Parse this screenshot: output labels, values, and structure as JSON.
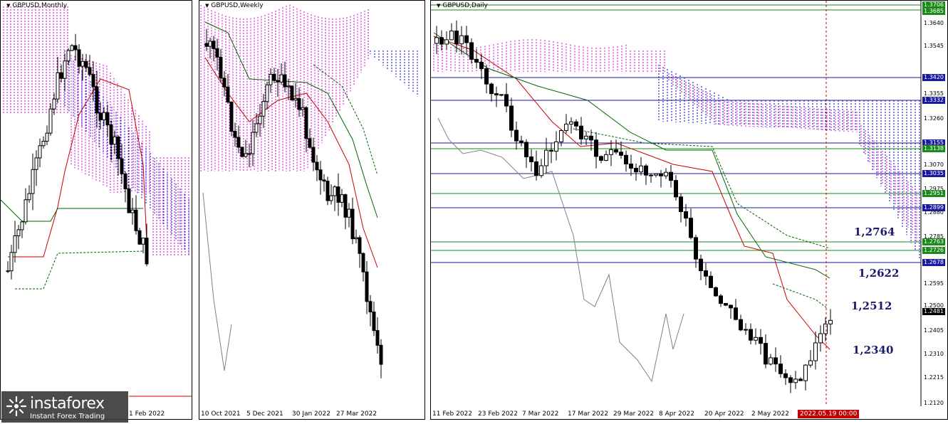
{
  "panels": {
    "monthly": {
      "title": "GBPUSD,Monthly",
      "xlabels": [
        "1 Feb 2022"
      ]
    },
    "weekly": {
      "title": "GBPUSD,Weekly",
      "xlabels": [
        "10 Oct 2021",
        "5 Dec 2021",
        "30 Jan 2022",
        "27 Mar 2022"
      ]
    },
    "daily": {
      "title": "GBPUSD,Daily",
      "xlabels": [
        "11 Feb 2022",
        "23 Feb 2022",
        "7 Mar 2022",
        "17 Mar 2022",
        "29 Mar 2022",
        "8 Apr 2022",
        "20 Apr 2022",
        "2 May 2022"
      ],
      "current_date": "2022.05.19 00:00",
      "price_scale": [
        "1.3640",
        "1.3545",
        "1.3450",
        "1.3355",
        "1.3260",
        "1.3070",
        "1.2975",
        "1.2880",
        "1.2785",
        "1.2595",
        "1.2500",
        "1.2405",
        "1.2310",
        "1.2215",
        "1.2120"
      ],
      "tags": [
        {
          "label": "1.3706",
          "color": "#1a8a1a"
        },
        {
          "label": "1.3685",
          "color": "#1a8a1a"
        },
        {
          "label": "1.3420",
          "color": "#1a1aa0"
        },
        {
          "label": "1.3332",
          "color": "#1a1aa0"
        },
        {
          "label": "1.3155",
          "color": "#1a1aa0"
        },
        {
          "label": "1.3138",
          "color": "#1a8a1a"
        },
        {
          "label": "1.3035",
          "color": "#1a1aa0"
        },
        {
          "label": "1.2951",
          "color": "#1a8a1a"
        },
        {
          "label": "1.2899",
          "color": "#1a1aa0"
        },
        {
          "label": "1.2763",
          "color": "#1a8a1a"
        },
        {
          "label": "1.2726",
          "color": "#1a8a1a"
        },
        {
          "label": "1.2678",
          "color": "#1a1aa0"
        },
        {
          "label": "1.2481",
          "color": "#000000"
        }
      ],
      "annotations": [
        "1,2764",
        "1,2622",
        "1,2512",
        "1,2340"
      ]
    }
  },
  "logo": {
    "name": "instaforex",
    "tagline": "Instant Forex Trading"
  },
  "colors": {
    "cloud": "#cc00cc",
    "cloud_blue": "#0000cc",
    "tenkan": "#cc0000",
    "kijun": "#006600",
    "chikou": "#808080",
    "level_blue": "#1a1aa0",
    "level_green": "#1a8a1a"
  },
  "chart_data": {
    "type": "candlestick",
    "instrument": "GBPUSD",
    "timeframe": "Daily",
    "ylim": [
      1.212,
      1.3706
    ],
    "levels": [
      1.3706,
      1.3685,
      1.342,
      1.3332,
      1.3155,
      1.3138,
      1.3035,
      1.2951,
      1.2899,
      1.2763,
      1.2726,
      1.2678
    ],
    "last_price": 1.2481,
    "annotated_levels": [
      1.2764,
      1.2622,
      1.2512,
      1.234
    ]
  }
}
